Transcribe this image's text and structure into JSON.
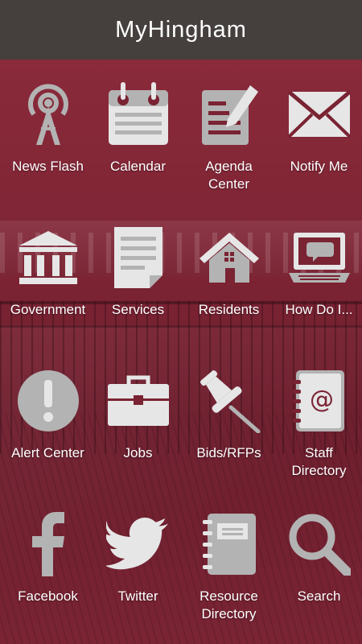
{
  "header": {
    "title": "MyHingham"
  },
  "tiles": [
    {
      "label": "News Flash",
      "icon": "broadcast-tower-icon"
    },
    {
      "label": "Calendar",
      "icon": "calendar-icon"
    },
    {
      "label": "Agenda\nCenter",
      "icon": "document-pencil-icon"
    },
    {
      "label": "Notify Me",
      "icon": "envelope-icon"
    },
    {
      "label": "Government",
      "icon": "government-building-icon"
    },
    {
      "label": "Services",
      "icon": "document-icon"
    },
    {
      "label": "Residents",
      "icon": "house-icon"
    },
    {
      "label": "How Do I...",
      "icon": "laptop-chat-icon"
    },
    {
      "label": "Alert Center",
      "icon": "exclamation-circle-icon"
    },
    {
      "label": "Jobs",
      "icon": "briefcase-icon"
    },
    {
      "label": "Bids/RFPs",
      "icon": "pushpin-icon"
    },
    {
      "label": "Staff\nDirectory",
      "icon": "address-book-icon"
    },
    {
      "label": "Facebook",
      "icon": "facebook-icon"
    },
    {
      "label": "Twitter",
      "icon": "twitter-bird-icon"
    },
    {
      "label": "Resource\nDirectory",
      "icon": "notebook-icon"
    },
    {
      "label": "Search",
      "icon": "magnifier-icon"
    }
  ],
  "colors": {
    "header": "#45403e",
    "background": "#7a2333",
    "icon": "#b3b3b3",
    "text": "#ffffff"
  }
}
